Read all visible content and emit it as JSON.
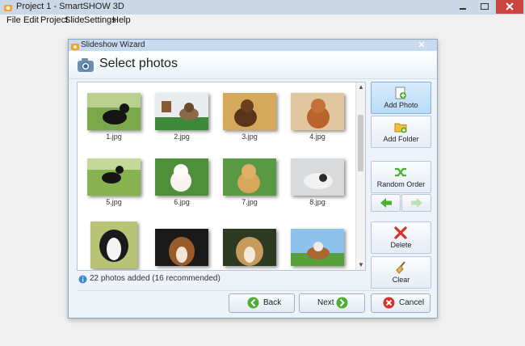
{
  "app": {
    "title": "Project 1 - SmartSHOW 3D"
  },
  "menu": [
    {
      "label": "File"
    },
    {
      "label": "Edit"
    },
    {
      "label": "Project"
    },
    {
      "label": "Slide"
    },
    {
      "label": "Settings"
    },
    {
      "label": "Help"
    }
  ],
  "dialog": {
    "title": "Slideshow Wizard",
    "heading": "Select photos",
    "photos": [
      {
        "label": "1.jpg"
      },
      {
        "label": "2.jpg"
      },
      {
        "label": "3.jpg"
      },
      {
        "label": "4.jpg"
      },
      {
        "label": "5.jpg"
      },
      {
        "label": "6.jpg"
      },
      {
        "label": "7.jpg"
      },
      {
        "label": "8.jpg"
      },
      {
        "label": ""
      },
      {
        "label": ""
      },
      {
        "label": ""
      },
      {
        "label": ""
      }
    ],
    "status": "22 photos added (16 recommended)",
    "side_buttons": {
      "add_photo": "Add Photo",
      "add_folder": "Add Folder",
      "random_order": "Random Order",
      "delete": "Delete",
      "clear": "Clear"
    },
    "bottom_buttons": {
      "back": "Back",
      "next": "Next",
      "cancel": "Cancel"
    }
  },
  "colors": {
    "accent": "#7fb3e0",
    "green": "#4caf32",
    "red": "#d9302a"
  }
}
